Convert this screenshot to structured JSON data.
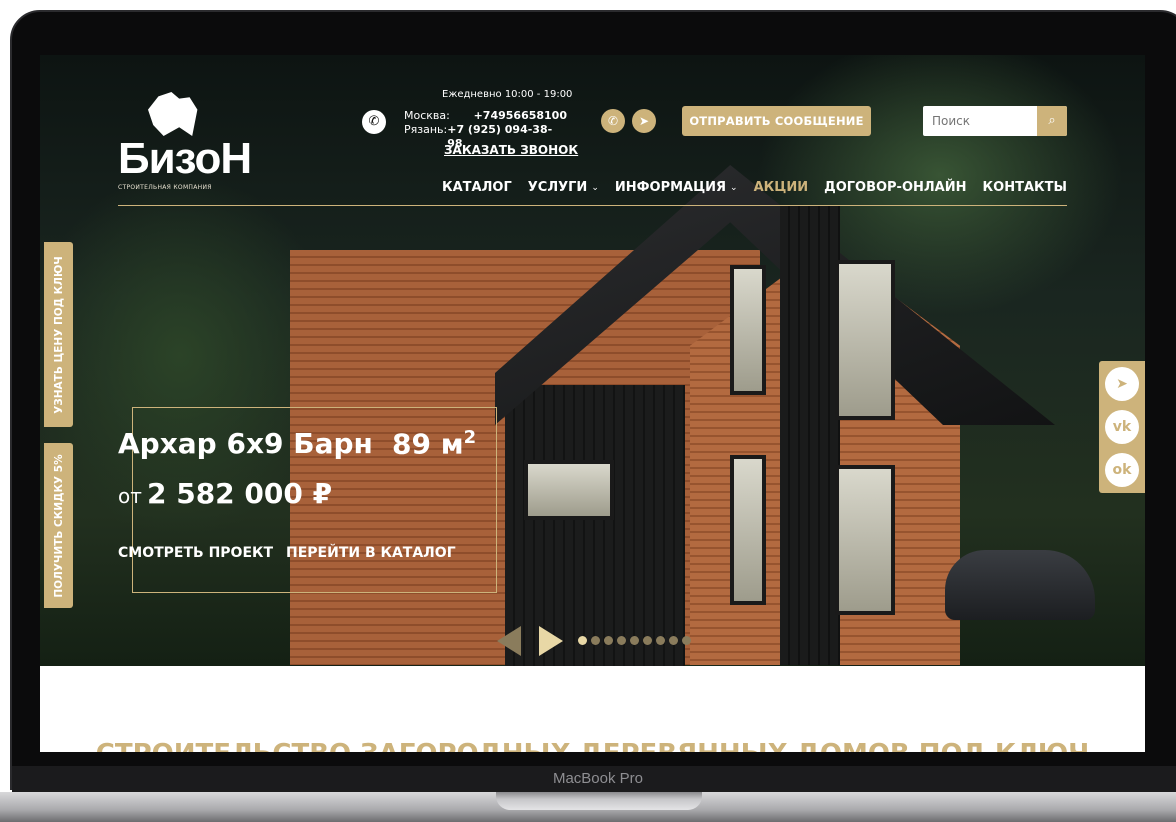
{
  "device": {
    "model_label": "MacBook Pro"
  },
  "header": {
    "logo_text": "БизоН",
    "logo_subtitle": "СТРОИТЕЛЬНАЯ КОМПАНИЯ",
    "hours": "Ежедневно 10:00 - 19:00",
    "phones": [
      {
        "city": "Москва:",
        "number": "+74956658100"
      },
      {
        "city": "Рязань:",
        "number": "+7 (925) 094-38-98"
      }
    ],
    "callback_label": "ЗАКАЗАТЬ ЗВОНОК",
    "messengers": [
      "whatsapp-icon",
      "telegram-icon"
    ],
    "send_message_label": "ОТПРАВИТЬ СООБЩЕНИЕ",
    "search": {
      "placeholder": "Поиск",
      "value": ""
    }
  },
  "nav": {
    "items": [
      {
        "label": "КАТАЛОГ",
        "dropdown": false,
        "active": false
      },
      {
        "label": "УСЛУГИ",
        "dropdown": true,
        "active": false
      },
      {
        "label": "ИНФОРМАЦИЯ",
        "dropdown": true,
        "active": false
      },
      {
        "label": "АКЦИИ",
        "dropdown": false,
        "active": true
      },
      {
        "label": "ДОГОВОР-ОНЛАЙН",
        "dropdown": false,
        "active": false
      },
      {
        "label": "КОНТАКТЫ",
        "dropdown": false,
        "active": false
      }
    ]
  },
  "side_tabs": {
    "price_label": "УЗНАТЬ ЦЕНУ ПОД КЛЮЧ",
    "discount_label": "ПОЛУЧИТЬ СКИДКУ 5%"
  },
  "social": [
    "telegram-icon",
    "vk-icon",
    "odnoklassniki-icon"
  ],
  "promo": {
    "title": "Архар 6х9 Барн",
    "area_value": "89 м",
    "area_sup": "2",
    "price_prefix": "от",
    "price": "2 582 000 ₽",
    "view_project_label": "СМОТРЕТЬ ПРОЕКТ",
    "catalog_label": "ПЕРЕЙТИ В КАТАЛОГ"
  },
  "slider": {
    "total_slides": 9,
    "active_slide": 1
  },
  "section": {
    "heading": "СТРОИТЕЛЬСТВО ЗАГОРОДНЫХ ДЕРЕВЯННЫХ ДОМОВ ПОД КЛЮЧ"
  },
  "colors": {
    "accent": "#cdb37b",
    "text_light": "#ffffff"
  }
}
